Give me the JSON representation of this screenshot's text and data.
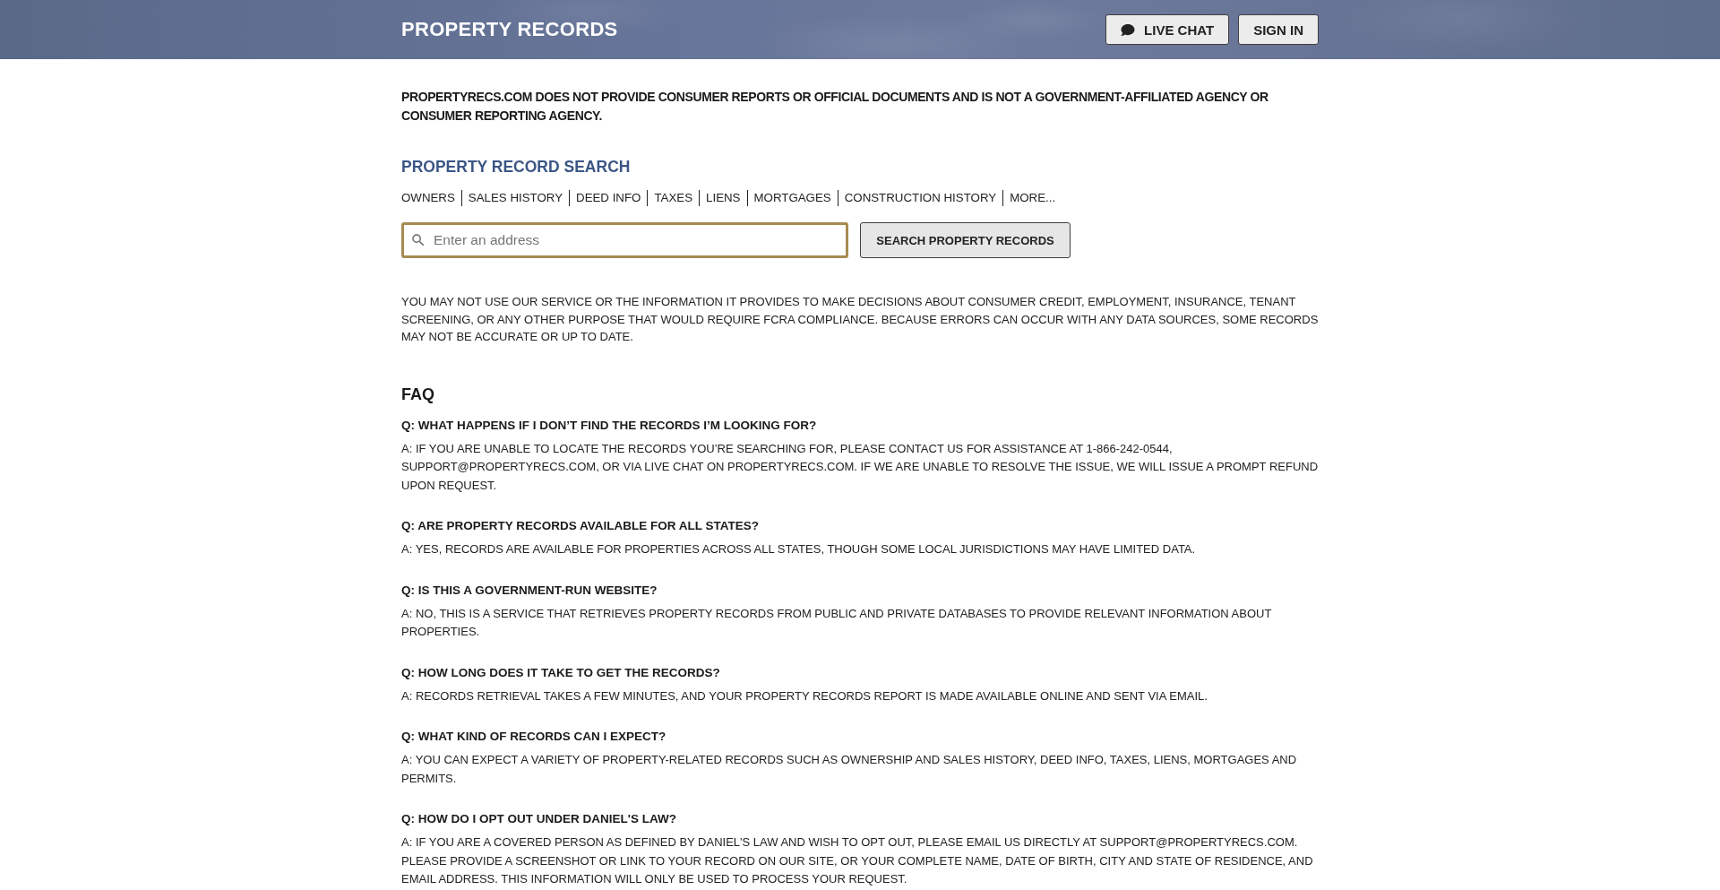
{
  "header": {
    "title": "PROPERTY RECORDS",
    "buttons": [
      {
        "label": "LIVE CHAT",
        "kind": "chat"
      },
      {
        "label": "SIGN IN",
        "kind": "signin"
      }
    ]
  },
  "disclaimer": "PROPERTYRECS.COM DOES NOT PROVIDE CONSUMER REPORTS OR OFFICIAL DOCUMENTS AND IS NOT A GOVERNMENT-AFFILIATED AGENCY OR CONSUMER REPORTING AGENCY.",
  "search": {
    "title": "PROPERTY RECORD SEARCH",
    "categories": [
      "OWNERS",
      "SALES HISTORY",
      "DEED INFO",
      "TAXES",
      "LIENS",
      "MORTGAGES",
      "CONSTRUCTION HISTORY",
      "MORE..."
    ],
    "placeholder": "Enter an address",
    "button": "SEARCH PROPERTY RECORDS"
  },
  "notice": "YOU MAY NOT USE OUR SERVICE OR THE INFORMATION IT PROVIDES TO MAKE DECISIONS ABOUT CONSUMER CREDIT, EMPLOYMENT, INSURANCE, TENANT SCREENING, OR ANY OTHER PURPOSE THAT WOULD REQUIRE FCRA COMPLIANCE. BECAUSE ERRORS CAN OCCUR WITH ANY DATA SOURCES, SOME RECORDS MAY NOT BE ACCURATE OR UP TO DATE.",
  "faq": {
    "title": "FAQ",
    "items": [
      {
        "question": "Q: WHAT HAPPENS IF I DON’T FIND THE RECORDS I’M LOOKING FOR?",
        "answer": "A: IF YOU ARE UNABLE TO LOCATE THE RECORDS YOU’RE SEARCHING FOR, PLEASE CONTACT US FOR ASSISTANCE AT 1-866-242-0544, SUPPORT@PROPERTYRECS.COM, OR VIA LIVE CHAT ON PROPERTYRECS.COM. IF WE ARE UNABLE TO RESOLVE THE ISSUE, WE WILL ISSUE A PROMPT REFUND UPON REQUEST."
      },
      {
        "question": "Q: ARE PROPERTY RECORDS AVAILABLE FOR ALL STATES?",
        "answer": "A: YES, RECORDS ARE AVAILABLE FOR PROPERTIES ACROSS ALL STATES, THOUGH SOME LOCAL JURISDICTIONS MAY HAVE LIMITED DATA."
      },
      {
        "question": "Q: IS THIS A GOVERNMENT-RUN WEBSITE?",
        "answer": "A: NO, THIS IS A SERVICE THAT RETRIEVES PROPERTY RECORDS FROM PUBLIC AND PRIVATE DATABASES TO PROVIDE RELEVANT INFORMATION ABOUT PROPERTIES."
      },
      {
        "question": "Q: HOW LONG DOES IT TAKE TO GET THE RECORDS?",
        "answer": "A: RECORDS RETRIEVAL TAKES A FEW MINUTES, AND YOUR PROPERTY RECORDS REPORT IS MADE AVAILABLE ONLINE AND SENT VIA EMAIL."
      },
      {
        "question": "Q: WHAT KIND OF RECORDS CAN I EXPECT?",
        "answer": "A: YOU CAN EXPECT A VARIETY OF PROPERTY-RELATED RECORDS SUCH AS OWNERSHIP AND SALES HISTORY, DEED INFO, TAXES, LIENS, MORTGAGES AND PERMITS."
      },
      {
        "question": "Q: HOW DO I OPT OUT UNDER DANIEL'S LAW?",
        "answer": "A: IF YOU ARE A COVERED PERSON AS DEFINED BY DANIEL'S LAW AND WISH TO OPT OUT, PLEASE EMAIL US DIRECTLY AT SUPPORT@PROPERTYRECS.COM. PLEASE PROVIDE A SCREENSHOT OR LINK TO YOUR RECORD ON OUR SITE, OR YOUR COMPLETE NAME, DATE OF BIRTH, CITY AND STATE OF RESIDENCE, AND EMAIL ADDRESS. THIS INFORMATION WILL ONLY BE USED TO PROCESS YOUR REQUEST."
      }
    ]
  }
}
